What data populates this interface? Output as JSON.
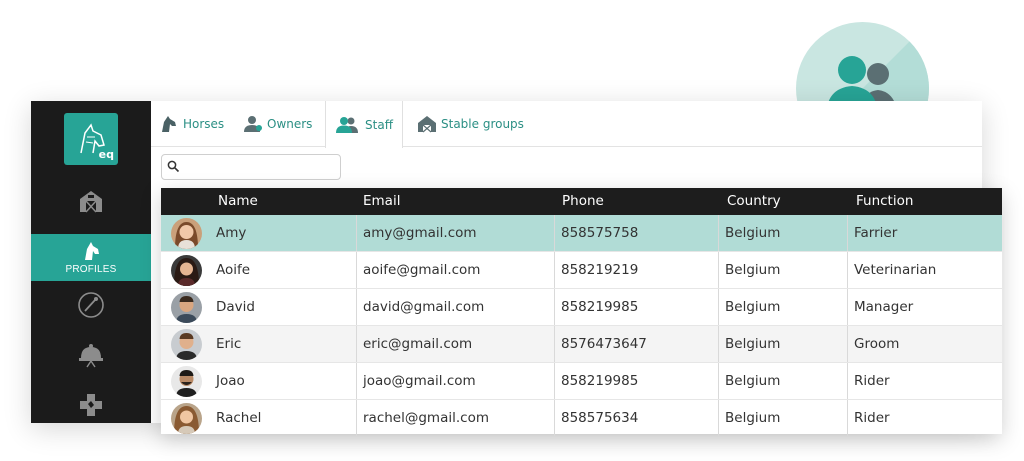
{
  "app": {
    "logo_text": "eq"
  },
  "sidebar": {
    "items": [
      {
        "icon": "barn-icon",
        "label": ""
      },
      {
        "icon": "horse-head-icon",
        "label": "PROFILES",
        "active": true
      },
      {
        "icon": "whip-icon",
        "label": ""
      },
      {
        "icon": "riding-helmet-icon",
        "label": ""
      },
      {
        "icon": "vet-cross-icon",
        "label": ""
      }
    ]
  },
  "tabs": [
    {
      "label": "Horses",
      "icon": "horse-head-icon"
    },
    {
      "label": "Owners",
      "icon": "owner-icon"
    },
    {
      "label": "Staff",
      "icon": "staff-icon",
      "active": true
    },
    {
      "label": "Stable groups",
      "icon": "stable-icon"
    }
  ],
  "search": {
    "value": "",
    "placeholder": ""
  },
  "table": {
    "columns": [
      "Name",
      "Email",
      "Phone",
      "Country",
      "Function"
    ],
    "rows": [
      {
        "name": "Amy",
        "email": "amy@gmail.com",
        "phone": "858575758",
        "country": "Belgium",
        "function": "Farrier",
        "highlighted": true
      },
      {
        "name": "Aoife",
        "email": "aoife@gmail.com",
        "phone": "858219219",
        "country": "Belgium",
        "function": "Veterinarian"
      },
      {
        "name": "David",
        "email": "david@gmail.com",
        "phone": "858219985",
        "country": "Belgium",
        "function": "Manager"
      },
      {
        "name": "Eric",
        "email": "eric@gmail.com",
        "phone": "8576473647",
        "country": "Belgium",
        "function": "Groom"
      },
      {
        "name": "Joao",
        "email": "joao@gmail.com",
        "phone": "858219985",
        "country": "Belgium",
        "function": "Rider"
      },
      {
        "name": "Rachel",
        "email": "rachel@gmail.com",
        "phone": "858575634",
        "country": "Belgium",
        "function": "Rider"
      }
    ]
  },
  "colors": {
    "accent": "#27a496",
    "tab_text": "#2b8f84",
    "row_highlight": "#b1dcd6",
    "sidebar_bg": "#1b1b1b",
    "table_header_bg": "#1d1d1d",
    "badge_bg": "#c9e6e1"
  }
}
